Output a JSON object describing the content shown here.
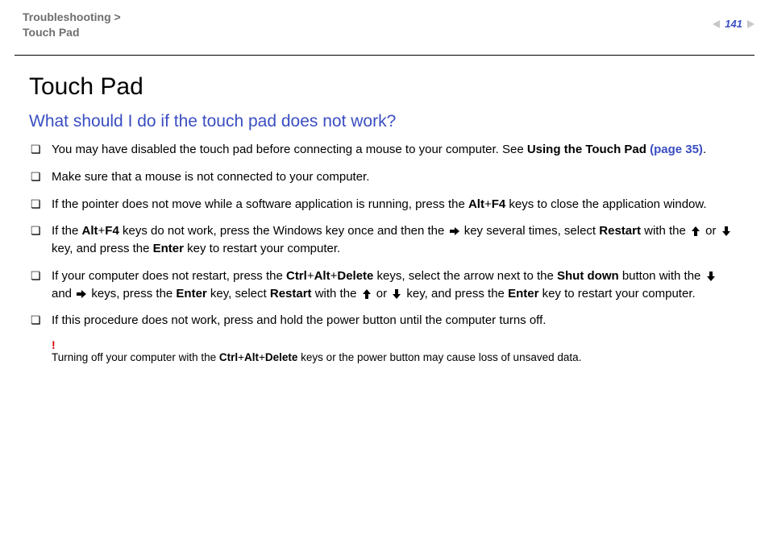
{
  "header": {
    "breadcrumb_parent": "Troubleshooting",
    "breadcrumb_sep": " >",
    "breadcrumb_child": "Touch Pad",
    "page_number": "141"
  },
  "title": "Touch Pad",
  "subtitle": "What should I do if the touch pad does not work?",
  "items": [
    {
      "t1": "You may have disabled the touch pad before connecting a mouse to your computer. See ",
      "b1": "Using the Touch Pad ",
      "link": "(page 35)",
      "t2": "."
    },
    {
      "t1": "Make sure that a mouse is not connected to your computer."
    },
    {
      "t1": "If the pointer does not move while a software application is running, press the ",
      "b1": "Alt",
      "plus1": "+",
      "b2": "F4",
      "t2": " keys to close the application window."
    },
    {
      "t1": "If the ",
      "b1": "Alt",
      "plus1": "+",
      "b2": "F4",
      "t2": " keys do not work, press the Windows key once and then the ",
      "arrow_right": true,
      "t3": " key several times, select ",
      "b3": "Restart",
      "t4": " with the ",
      "arrow_up": true,
      "t5": " or ",
      "arrow_down": true,
      "t6": " key, and press the ",
      "b4": "Enter",
      "t7": " key to restart your computer."
    },
    {
      "t1": "If your computer does not restart, press the ",
      "b1": "Ctrl",
      "plus1": "+",
      "b2": "Alt",
      "plus2": "+",
      "b3": "Delete",
      "t2": " keys, select the arrow next to the ",
      "b4": "Shut down",
      "t3": " button with the ",
      "arrow_down": true,
      "t4": " and ",
      "arrow_right": true,
      "t5": " keys, press the ",
      "b5": "Enter",
      "t6": " key, select ",
      "b6": "Restart",
      "t7": " with the ",
      "arrow_up2": true,
      "t8": " or ",
      "arrow_down2": true,
      "t9": " key, and press the ",
      "b7": "Enter",
      "t10": " key to restart your computer."
    },
    {
      "t1": "If this procedure does not work, press and hold the power button until the computer turns off."
    }
  ],
  "note": {
    "mark": "!",
    "text_pre": "Turning off your computer with the ",
    "b1": "Ctrl",
    "plus1": "+",
    "b2": "Alt",
    "plus2": "+",
    "b3": "Delete",
    "text_post": " keys or the power button may cause loss of unsaved data."
  }
}
